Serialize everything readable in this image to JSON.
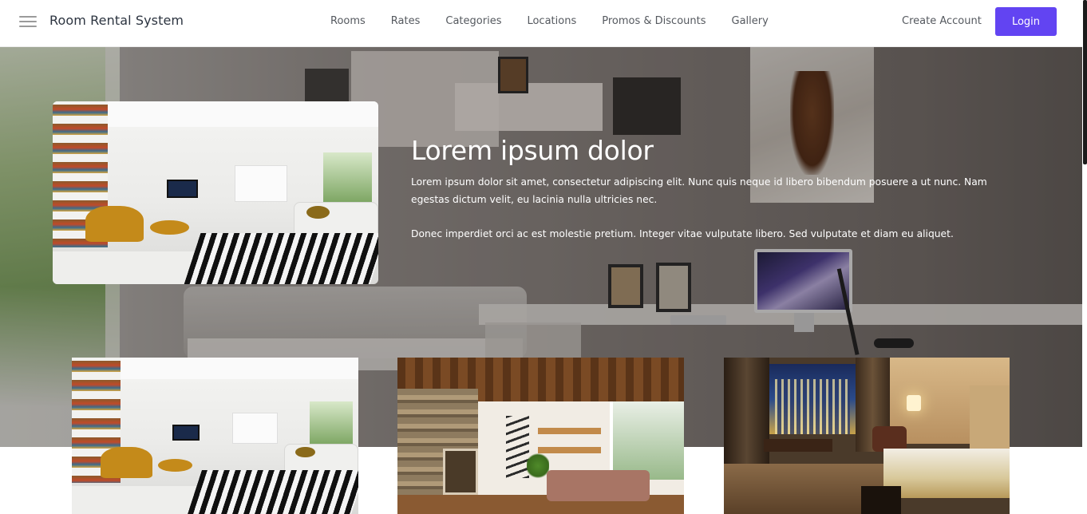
{
  "navbar": {
    "brand": "Room Rental System",
    "links": [
      "Rooms",
      "Rates",
      "Categories",
      "Locations",
      "Promos & Discounts",
      "Gallery"
    ],
    "create_account": "Create Account",
    "login": "Login",
    "login_color": "#6244f2"
  },
  "hero": {
    "title": "Lorem ipsum dolor",
    "paragraph_1": "Lorem ipsum dolor sit amet, consectetur adipiscing elit. Nunc quis neque id libero bibendum posuere a ut nunc. Nam egestas dictum velit, eu lacinia nulla ultricies nec.",
    "paragraph_2": "Donec imperdiet orci ac est molestie pretium. Integer vitae vulputate libero. Sed vulputate et diam eu aliquet."
  },
  "icons": {
    "menu": "hamburger-menu-icon"
  }
}
